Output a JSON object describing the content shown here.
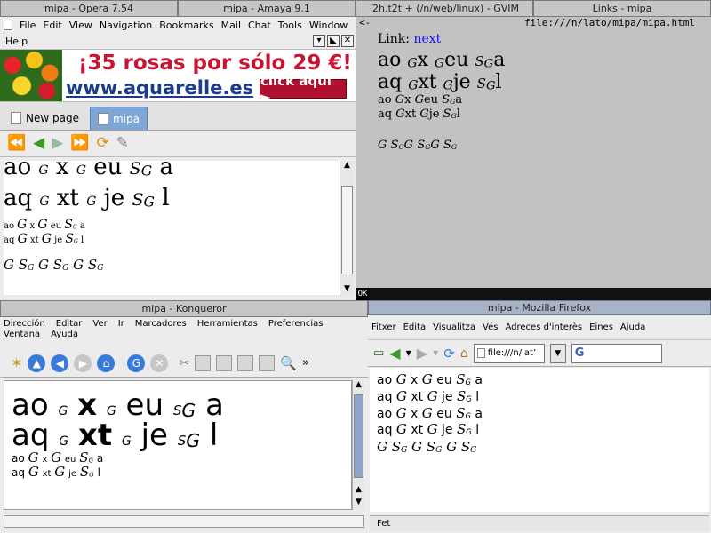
{
  "opera": {
    "title": "mipa - Opera 7.54",
    "menu": [
      "File",
      "Edit",
      "View",
      "Navigation",
      "Bookmarks",
      "Mail",
      "Chat",
      "Tools",
      "Window"
    ],
    "menu2": [
      "Help"
    ],
    "banner": {
      "headline": "¡35 rosas por sólo 29 €!",
      "url": "www.aquarelle.es",
      "button": "click aquí ►"
    },
    "tabs": [
      "New page",
      "mipa"
    ],
    "content": {
      "l1": [
        "ao",
        "G",
        "x",
        "G",
        "eu",
        "S",
        "G",
        "a"
      ],
      "l2": [
        "aq",
        "G",
        "xt",
        "G",
        "je",
        "S",
        "G",
        "l"
      ]
    }
  },
  "amaya": {
    "title": "mipa - Amaya 9.1"
  },
  "gvim": {
    "title": "l2h.t2t + (/n/web/linux) - GVIM"
  },
  "links": {
    "title": "Links - mipa",
    "back": "<-",
    "url": "file:///n/lato/mipa/mipa.html",
    "link_label": "Link:",
    "link_text": "next",
    "ok": "OK"
  },
  "konqueror": {
    "title": "mipa - Konqueror",
    "menu": [
      "Dirección",
      "Editar",
      "Ver",
      "Ir",
      "Marcadores",
      "Herramientas",
      "Preferencias",
      "Ventana",
      "Ayuda"
    ]
  },
  "firefox": {
    "title": "mipa - Mozilla Firefox",
    "menu": [
      "Fitxer",
      "Edita",
      "Visualitza",
      "Vés",
      "Adreces d'interès",
      "Eines",
      "Ajuda"
    ],
    "url": "file:///n/lat’",
    "status": "Fet"
  },
  "text": {
    "ao": "ao",
    "aq": "aq",
    "x": "x",
    "xt": "xt",
    "eu": "eu",
    "je": "je",
    "a": "a",
    "l": "l",
    "G": "G",
    "S": "S"
  }
}
